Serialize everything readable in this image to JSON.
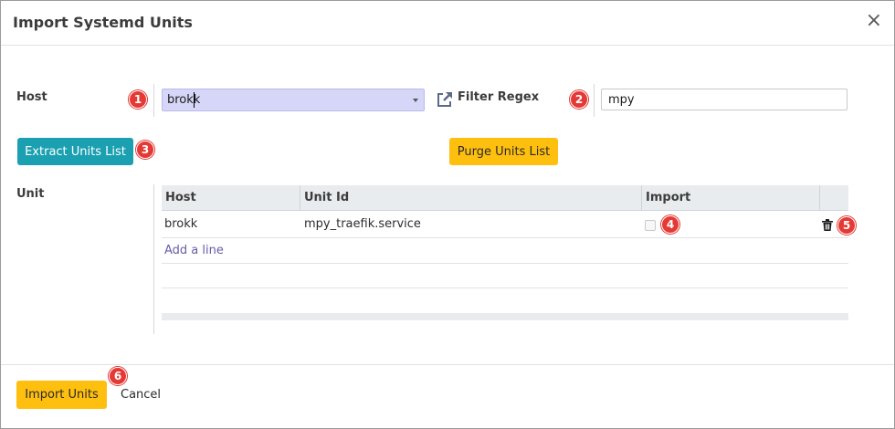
{
  "dialog": {
    "title": "Import Systemd Units",
    "close_icon": "close-icon"
  },
  "form": {
    "host_label": "Host",
    "host_value": "brokk",
    "filter_label": "Filter Regex",
    "filter_value": "mpy",
    "unit_label": "Unit"
  },
  "buttons": {
    "extract": "Extract Units List",
    "purge": "Purge Units List",
    "import": "Import Units",
    "cancel": "Cancel"
  },
  "table": {
    "columns": [
      "Host",
      "Unit Id",
      "Import"
    ],
    "rows": [
      {
        "host": "brokk",
        "unit_id": "mpy_traefik.service",
        "import": false
      }
    ],
    "add_line": "Add a line"
  },
  "badges": [
    "1",
    "2",
    "3",
    "4",
    "5",
    "6"
  ],
  "colors": {
    "teal": "#1aa0b0",
    "amber": "#ffbf0f",
    "badge_red": "#e53935",
    "select_highlight": "#d5d6f8",
    "link": "#6a5aa8"
  }
}
